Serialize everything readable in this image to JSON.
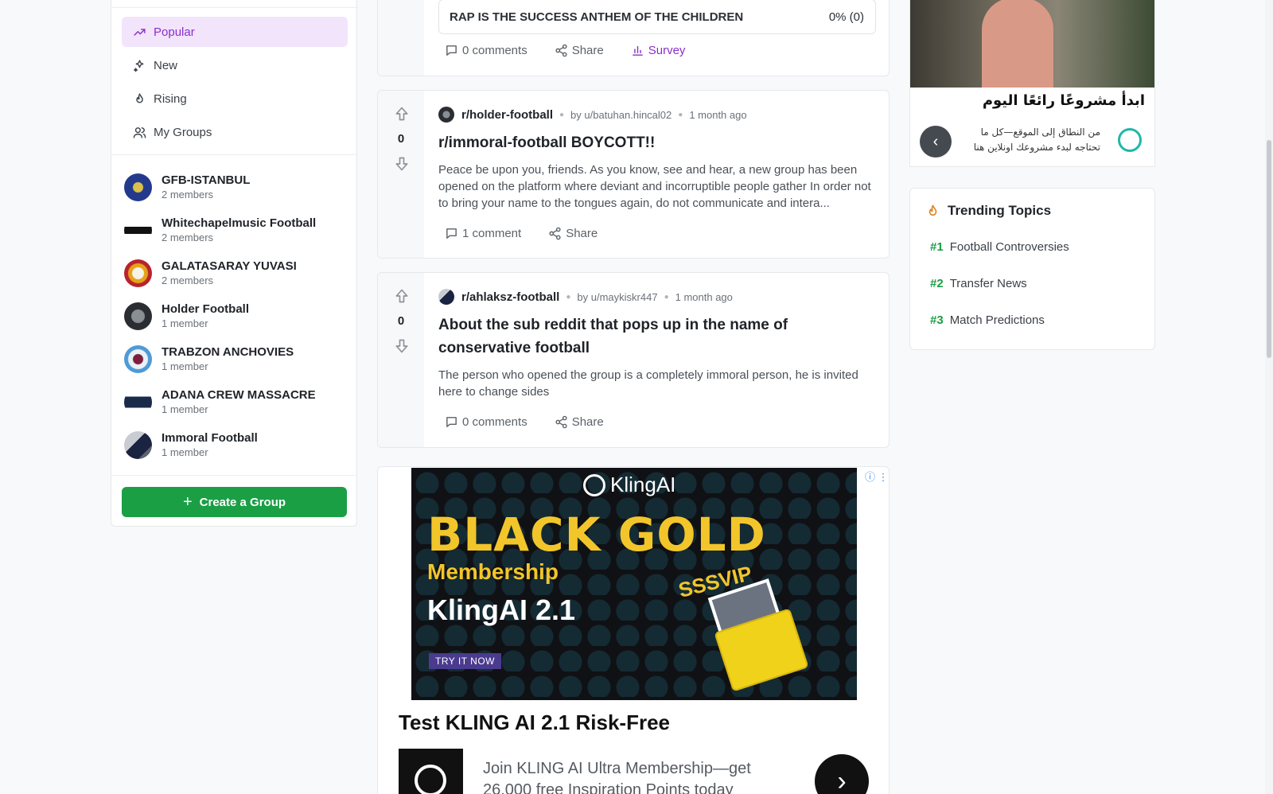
{
  "nav": {
    "items": [
      {
        "label": "Popular",
        "icon": "trending-icon"
      },
      {
        "label": "New",
        "icon": "sparkles-icon"
      },
      {
        "label": "Rising",
        "icon": "flame-icon"
      },
      {
        "label": "My Groups",
        "icon": "users-icon"
      }
    ]
  },
  "groups": [
    {
      "name": "GFB-ISTANBUL",
      "members": "2 members"
    },
    {
      "name": "Whitechapelmusic Football",
      "members": "2 members"
    },
    {
      "name": "GALATASARAY YUVASI",
      "members": "2 members"
    },
    {
      "name": "Holder Football",
      "members": "1 member"
    },
    {
      "name": "TRABZON ANCHOVIES",
      "members": "1 member"
    },
    {
      "name": "ADANA CREW MASSACRE",
      "members": "1 member"
    },
    {
      "name": "Immoral Football",
      "members": "1 member"
    }
  ],
  "create_group_label": "Create a Group",
  "posts": [
    {
      "poll_option": "RAP IS THE SUCCESS ANTHEM OF THE CHILDREN",
      "poll_result": "0% (0)",
      "comments": "0 comments",
      "share": "Share",
      "survey": "Survey"
    },
    {
      "votes": "0",
      "subreddit": "r/holder-football",
      "author": "by u/batuhan.hincal02",
      "time": "1 month ago",
      "title": "r/immoral-football BOYCOTT!!",
      "body": "Peace be upon you, friends. As you know, see and hear, a new group has been opened on the platform where deviant and incorruptible people gather In order not to bring your name to the tongues again, do not communicate and intera...",
      "comments": "1 comment",
      "share": "Share"
    },
    {
      "votes": "0",
      "subreddit": "r/ahlaksz-football",
      "author": "by u/maykiskr447",
      "time": "1 month ago",
      "title": "About the sub reddit that pops up in the name of conservative football",
      "body": "The person who opened the group is a completely immoral person, he is invited here to change sides",
      "comments": "0 comments",
      "share": "Share"
    }
  ],
  "ad": {
    "brand": "KlingAI",
    "headline": "BLACK GOLD",
    "sub": "Membership",
    "product": "KlingAI 2.1",
    "tag": "SSSVIP",
    "cta_small": "TRY IT NOW",
    "title": "Test KLING AI 2.1 Risk-Free",
    "desc": "Join KLING AI Ultra Membership—get 26,000 free Inspiration Points today"
  },
  "side_ad": {
    "title": "ابدأ مشروعًا رائعًا اليوم",
    "desc_line1": "من النطاق إلى الموقع—كل ما",
    "desc_line2": "تحتاجه لبدء مشروعك اونلاين هنا"
  },
  "trending": {
    "title": "Trending Topics",
    "topics": [
      {
        "rank": "#1",
        "label": "Football Controversies"
      },
      {
        "rank": "#2",
        "label": "Transfer News"
      },
      {
        "rank": "#3",
        "label": "Match Predictions"
      }
    ]
  },
  "colors": {
    "accent_purple": "#8b2fc9",
    "accent_green": "#1a9f45"
  }
}
